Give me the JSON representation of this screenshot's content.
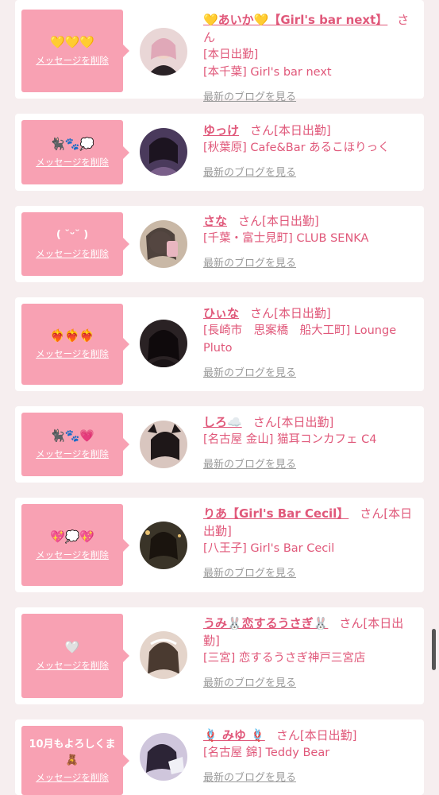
{
  "messages": [
    {
      "bubble_text": "💛💛💛",
      "delete_label": "メッセージを削除",
      "name": "💛あいか💛【Girl's bar next】",
      "suffix": "さん",
      "status": "[本日出勤]",
      "shop": "[本千葉] Girl's bar next",
      "blog_label": "最新のブログを見る",
      "avatar_color": "#d8b8b8"
    },
    {
      "bubble_text": "🐈‍⬛🐾💭",
      "delete_label": "メッセージを削除",
      "name": "ゆっけ",
      "suffix": "さん",
      "status": "[本日出勤]",
      "shop": "[秋葉原] Cafe&Bar あるこほりっく",
      "blog_label": "最新のブログを見る",
      "avatar_color": "#5a4a6a"
    },
    {
      "bubble_text": "( ˘ᵕ˘ )",
      "delete_label": "メッセージを削除",
      "name": "さな",
      "suffix": "さん",
      "status": "[本日出勤]",
      "shop": "[千葉・富士見町] CLUB SENKA",
      "blog_label": "最新のブログを見る",
      "avatar_color": "#b8a592"
    },
    {
      "bubble_text": "❤️‍🔥❤️‍🔥❤️‍🔥",
      "delete_label": "メッセージを削除",
      "name": "ひぃな",
      "suffix": "さん",
      "status": "[本日出勤]",
      "shop": "[長崎市　思案橋　船大工町] Lounge Pluto",
      "blog_label": "最新のブログを見る",
      "avatar_color": "#3b3335"
    },
    {
      "bubble_text": "🐈‍⬛🐾💗",
      "delete_label": "メッセージを削除",
      "name": "しろ☁️",
      "suffix": "さん",
      "status": "[本日出勤]",
      "shop": "[名古屋 金山] 猫耳コンカフェ C4",
      "blog_label": "最新のブログを見る",
      "avatar_color": "#d2c0b8"
    },
    {
      "bubble_text": "💖💭💖",
      "delete_label": "メッセージを削除",
      "name": "りあ【Girl's Bar Cecil】",
      "suffix": "さん",
      "status": "[本日出勤]",
      "shop": "[八王子] Girl's Bar Cecil",
      "blog_label": "最新のブログを見る",
      "avatar_color": "#4a4438"
    },
    {
      "bubble_text": "🤍",
      "delete_label": "メッセージを削除",
      "name": "うみ🐰恋するうさぎ🐰",
      "suffix": "さん",
      "status": "[本日出勤]",
      "shop": "[三宮] 恋するうさぎ神戸三宮店",
      "blog_label": "最新のブログを見る",
      "avatar_color": "#dcc9bd"
    },
    {
      "bubble_text": "10月もよろしくま🧸",
      "delete_label": "メッセージを削除",
      "name": "🪢 みゆ 🪢",
      "suffix": "さん",
      "status": "[本日出勤]",
      "shop": "[名古屋 錦] Teddy Bear",
      "blog_label": "最新のブログを見る",
      "avatar_color": "#c8c0d8"
    }
  ]
}
